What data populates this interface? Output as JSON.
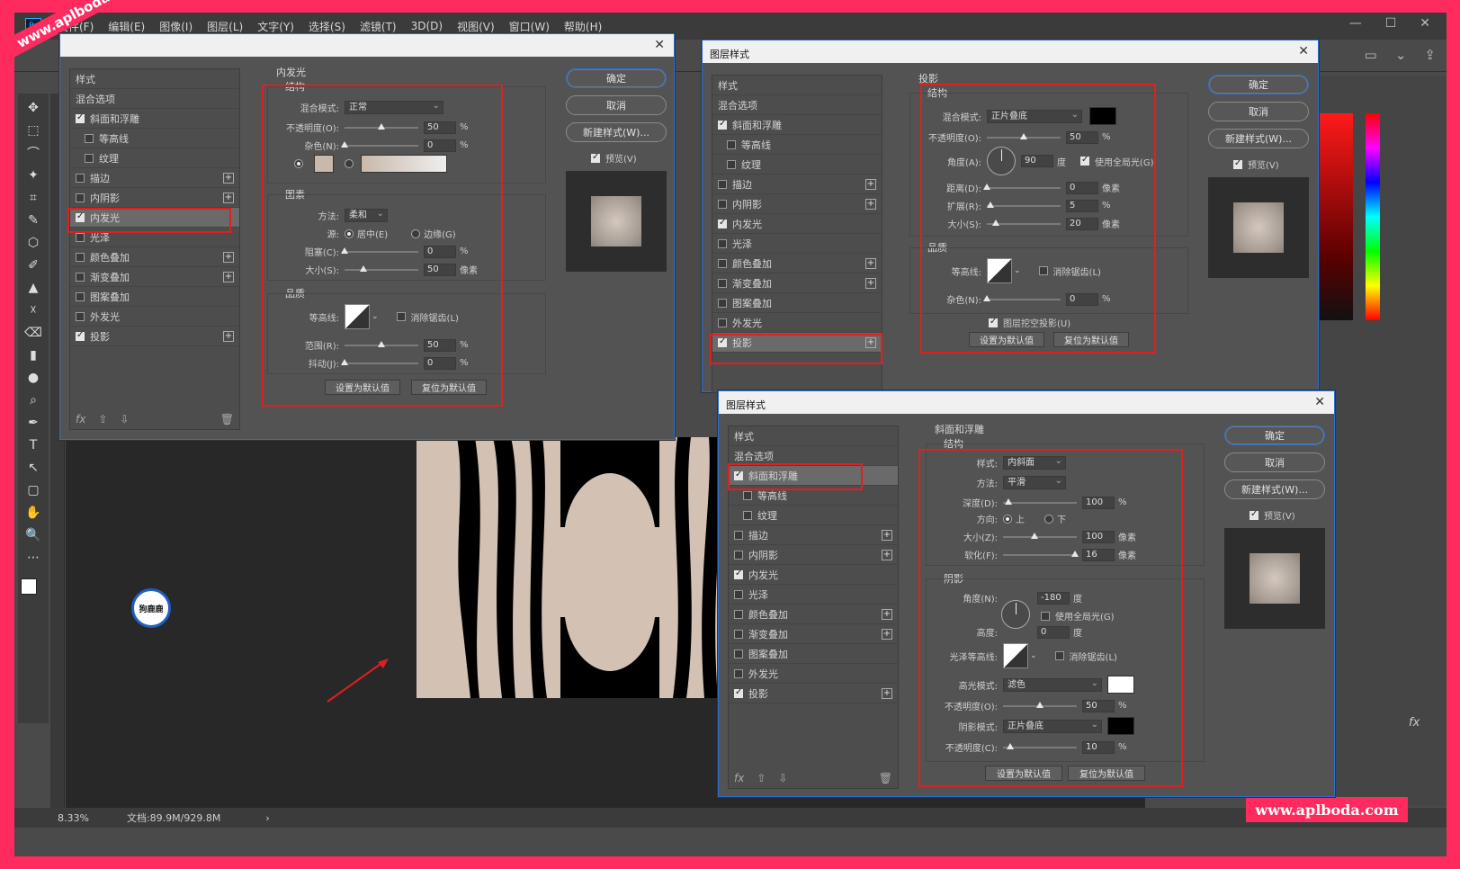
{
  "menu": [
    "Ps",
    "文件(F)",
    "编辑(E)",
    "图像(I)",
    "图层(L)",
    "文字(Y)",
    "选择(S)",
    "滤镜(T)",
    "3D(D)",
    "视图(V)",
    "窗口(W)",
    "帮助(H)"
  ],
  "winbtns": [
    "—",
    "☐",
    "✕"
  ],
  "opt_icons": [
    "▭",
    "⌄",
    "⇪"
  ],
  "tools": [
    "✥",
    "⬚",
    "⌒",
    "✦",
    "⌗",
    "✎",
    "⬡",
    "✐",
    "▲",
    "☓",
    "⌫",
    "▮",
    "●",
    "⌕",
    "✒",
    "T",
    "↖",
    "▢",
    "✋",
    "🔍",
    "⋯"
  ],
  "status": {
    "zoom": "8.33%",
    "doc": "文档:89.9M/929.8M",
    "arrow": "›"
  },
  "watermark": {
    "top": "www.aplboda.com",
    "bottom": "www.aplboda.com"
  },
  "logo_text": "狗鹿鹿",
  "fx_r": "fx",
  "common": {
    "ok": "确定",
    "cancel": "取消",
    "new_style": "新建样式(W)...",
    "preview": "预览(V)",
    "set_default": "设置为默认值",
    "reset_default": "复位为默认值",
    "close": "✕",
    "fx": "fx",
    "up": "⇧",
    "down": "⇩",
    "trash": "🗑",
    "plus": "+"
  },
  "dlg1": {
    "title": "",
    "list": [
      "样式",
      "混合选项",
      "斜面和浮雕",
      "等高线",
      "纹理",
      "描边",
      "内阴影",
      "内发光",
      "光泽",
      "颜色叠加",
      "渐变叠加",
      "图案叠加",
      "外发光",
      "投影"
    ],
    "heading": "内发光",
    "sub": "结构",
    "blend_label": "混合模式:",
    "blend_val": "正常",
    "opacity_label": "不透明度(O):",
    "opacity_val": "50",
    "opacity_unit": "%",
    "noise_label": "杂色(N):",
    "noise_val": "0",
    "noise_unit": "%",
    "elements_title": "图素",
    "method_label": "方法:",
    "method_val": "柔和",
    "source_label": "源:",
    "src_center": "居中(E)",
    "src_edge": "边缘(G)",
    "choke_label": "阻塞(C):",
    "choke_val": "0",
    "choke_unit": "%",
    "size_label": "大小(S):",
    "size_val": "50",
    "size_unit": "像素",
    "quality_title": "品质",
    "contour_label": "等高线:",
    "antialias": "消除锯齿(L)",
    "range_label": "范围(R):",
    "range_val": "50",
    "range_unit": "%",
    "jitter_label": "抖动(J):",
    "jitter_val": "0",
    "jitter_unit": "%"
  },
  "dlg2": {
    "title": "图层样式",
    "list": [
      "样式",
      "混合选项",
      "斜面和浮雕",
      "等高线",
      "纹理",
      "描边",
      "内阴影",
      "内发光",
      "光泽",
      "颜色叠加",
      "渐变叠加",
      "图案叠加",
      "外发光",
      "投影"
    ],
    "heading": "投影",
    "sub": "结构",
    "blend_label": "混合模式:",
    "blend_val": "正片叠底",
    "opacity_label": "不透明度(O):",
    "opacity_val": "50",
    "opacity_unit": "%",
    "angle_label": "角度(A):",
    "angle_val": "90",
    "angle_unit": "度",
    "global_light": "使用全局光(G)",
    "distance_label": "距离(D):",
    "distance_val": "0",
    "distance_unit": "像素",
    "spread_label": "扩展(R):",
    "spread_val": "5",
    "spread_unit": "%",
    "size_label": "大小(S):",
    "size_val": "20",
    "size_unit": "像素",
    "quality_title": "品质",
    "contour_label": "等高线:",
    "antialias": "消除锯齿(L)",
    "noise_label": "杂色(N):",
    "noise_val": "0",
    "noise_unit": "%",
    "knockout": "图层挖空投影(U)"
  },
  "dlg3": {
    "title": "图层样式",
    "list": [
      "样式",
      "混合选项",
      "斜面和浮雕",
      "等高线",
      "纹理",
      "描边",
      "内阴影",
      "内发光",
      "光泽",
      "颜色叠加",
      "渐变叠加",
      "图案叠加",
      "外发光",
      "投影"
    ],
    "heading": "斜面和浮雕",
    "sub": "结构",
    "style_label": "样式:",
    "style_val": "内斜面",
    "method_label": "方法:",
    "method_val": "平滑",
    "depth_label": "深度(D):",
    "depth_val": "100",
    "depth_unit": "%",
    "dir_label": "方向:",
    "dir_up": "上",
    "dir_down": "下",
    "size_label": "大小(Z):",
    "size_val": "100",
    "size_unit": "像素",
    "soften_label": "软化(F):",
    "soften_val": "16",
    "soften_unit": "像素",
    "shading_title": "阴影",
    "angle_label": "角度(N):",
    "angle_val": "-180",
    "angle_unit": "度",
    "global_light": "使用全局光(G)",
    "altitude_label": "高度:",
    "altitude_val": "0",
    "altitude_unit": "度",
    "gloss_label": "光泽等高线:",
    "antialias": "消除锯齿(L)",
    "hl_mode_label": "高光模式:",
    "hl_mode_val": "滤色",
    "hl_op_label": "不透明度(O):",
    "hl_op_val": "50",
    "hl_op_unit": "%",
    "sh_mode_label": "阴影模式:",
    "sh_mode_val": "正片叠底",
    "sh_op_label": "不透明度(C):",
    "sh_op_val": "10",
    "sh_op_unit": "%"
  },
  "colors": {
    "accent": "#2a6fd6",
    "redbox": "#e02020",
    "bg": "#ff2a5e",
    "swatch_beige": "#c9b9aa",
    "shadow_color": "#000000",
    "highlight_color": "#ffffff"
  }
}
